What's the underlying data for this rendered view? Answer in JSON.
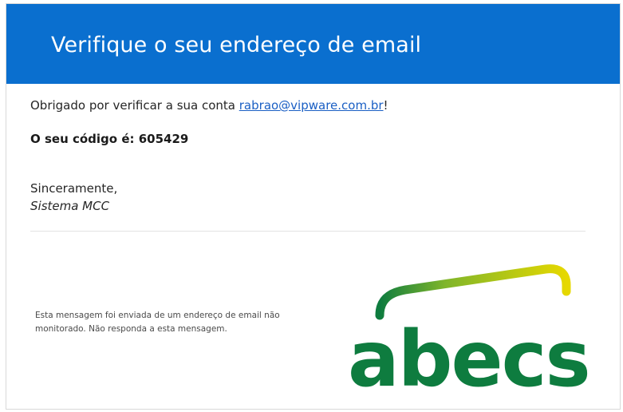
{
  "header": {
    "title": "Verifique o seu endereço de email"
  },
  "body": {
    "thanks_prefix": "Obrigado por verificar a sua conta ",
    "email_link": "rabrao@vipware.com.br",
    "thanks_suffix": "!",
    "code_line": "O seu código é: 605429",
    "signoff": "Sinceramente,",
    "signature": "Sistema MCC"
  },
  "footer": {
    "note": "Esta mensagem foi enviada de um endereço de email não monitorado. Não responda a esta mensagem.",
    "logo_text": "abecs"
  },
  "colors": {
    "header_background": "#0a6fcf",
    "link": "#1a5fc4",
    "logo_green": "#0e7c3f",
    "logo_yellow": "#e6d800"
  }
}
